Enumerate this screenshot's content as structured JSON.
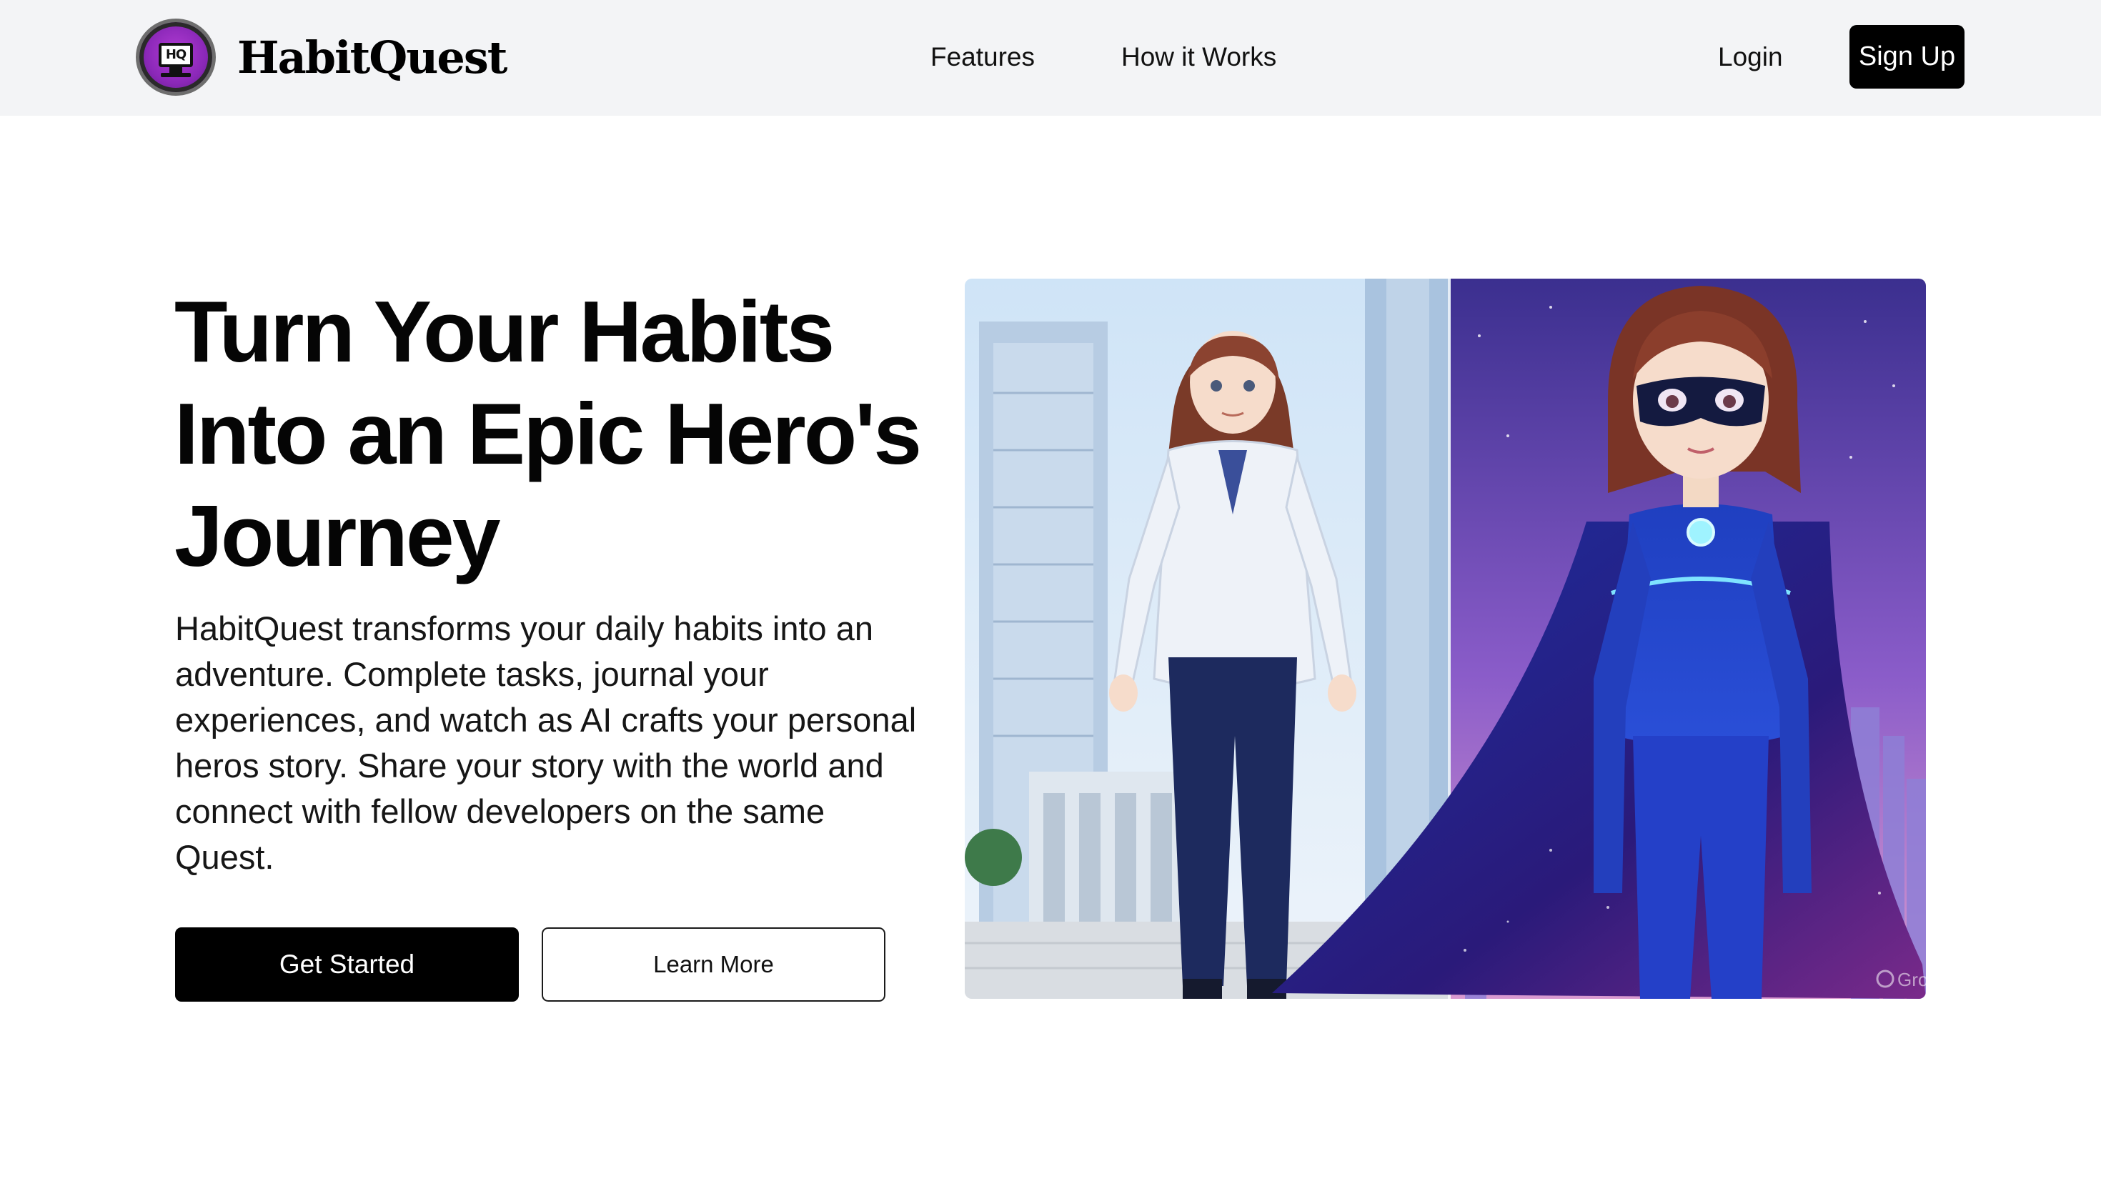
{
  "header": {
    "brand": {
      "logo_text": "HQ",
      "name": "HabitQuest"
    },
    "nav": [
      {
        "label": "Features"
      },
      {
        "label": "How it Works"
      }
    ],
    "login_label": "Login",
    "signup_label": "Sign Up"
  },
  "hero": {
    "title_lines": [
      "Turn Your Habits",
      "Into an Epic Hero's",
      "Journey"
    ],
    "description": "HabitQuest transforms your daily habits into an adventure. Complete tasks, journal your experiences, and watch as AI crafts your personal heros story. Share your story with the world and connect with fellow developers on the same Quest.",
    "primary_cta": "Get Started",
    "secondary_cta": "Learn More",
    "image": {
      "watermark": "Grok",
      "icon": "anime-hero-transformation-illustration"
    }
  },
  "colors": {
    "header_bg": "#f3f4f6",
    "button_dark": "#000000",
    "logo_purple": "#8b28b8"
  }
}
